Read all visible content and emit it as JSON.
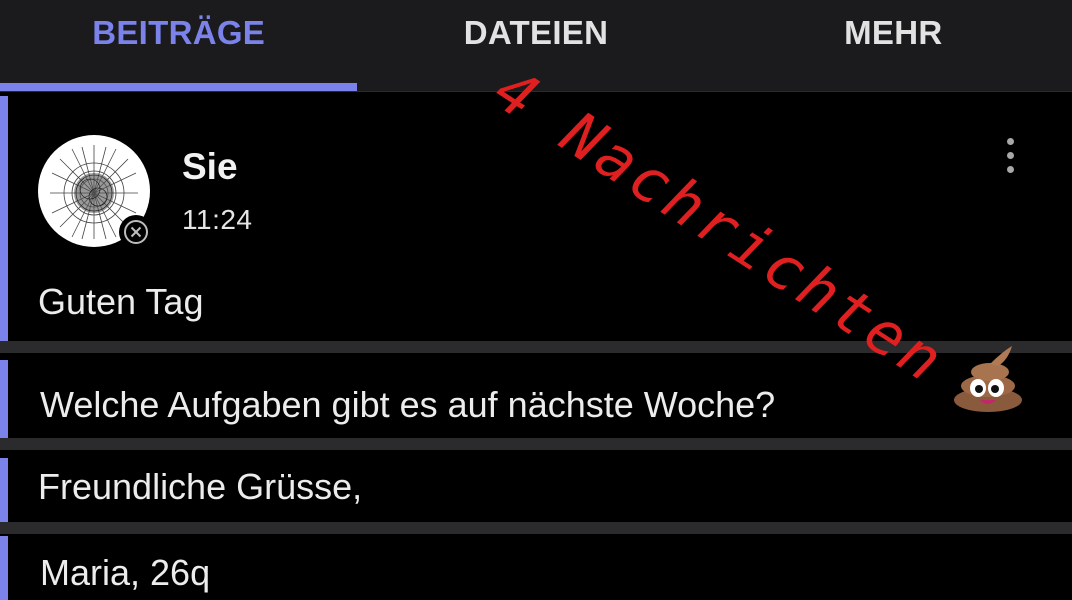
{
  "tabs": [
    {
      "label": "BEITRÄGE",
      "active": true
    },
    {
      "label": "DATEIEN",
      "active": false
    },
    {
      "label": "MEHR",
      "active": false
    }
  ],
  "post": {
    "author": "Sie",
    "time": "11:24",
    "messages": [
      "Guten Tag",
      "Welche Aufgaben gibt es auf nächste Woche?",
      "Freundliche Grüsse,",
      "Maria, 26q"
    ]
  },
  "annotation": {
    "text": "4 Nachrichten",
    "color": "#e02020"
  },
  "colors": {
    "accent": "#7b83eb",
    "background": "#000000",
    "tab_bar": "#1b1b1d"
  },
  "icons": {
    "more": "more-vertical-icon",
    "status": "offline-status-icon",
    "sticker": "poop-emoji-icon"
  }
}
